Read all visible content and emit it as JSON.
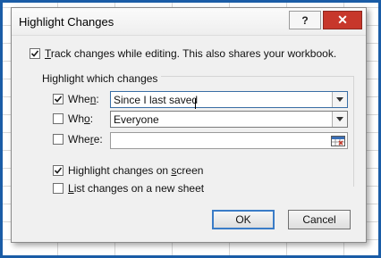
{
  "dialog": {
    "title": "Highlight Changes",
    "help_label": "?",
    "close_label": "✕"
  },
  "track_changes": {
    "label": "Track changes while editing. This also shares your workbook.",
    "checked": true
  },
  "group": {
    "title": "Highlight which changes",
    "when": {
      "label": "When:",
      "checked": true,
      "value": "Since I last saved"
    },
    "who": {
      "label": "Who:",
      "checked": false,
      "value": "Everyone"
    },
    "where": {
      "label": "Where:",
      "checked": false,
      "value": ""
    }
  },
  "highlight_on_screen": {
    "label": "Highlight changes on screen",
    "checked": true
  },
  "list_on_new_sheet": {
    "label": "List changes on a new sheet",
    "checked": false
  },
  "buttons": {
    "ok": "OK",
    "cancel": "Cancel"
  },
  "icons": {
    "help": "help-icon",
    "close": "close-icon",
    "dropdown": "chevron-down-icon",
    "range_select": "range-select-icon",
    "check": "check-icon"
  }
}
